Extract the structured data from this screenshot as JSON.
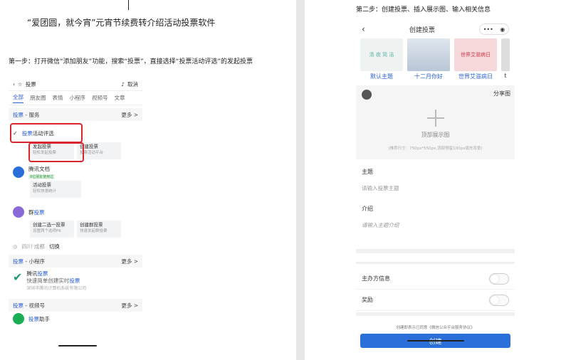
{
  "left": {
    "doc_title": "“爱团圆，就今宵”元宵节续费转介绍活动投票软件",
    "step1_text": "第一步：打开微信“添加朋友”功能，搜索“投票”，直接选择“投票活动评选”的发起投票",
    "search": {
      "query": "投票",
      "cancel": "取消"
    },
    "tabs": [
      "全部",
      "朋友圈",
      "表情",
      "小程序",
      "视频号",
      "文章"
    ],
    "service_section": {
      "title_prefix": "投票",
      "title_suffix": " - 服务",
      "more": "更多 >"
    },
    "item1": {
      "name_prefix": "投票",
      "name_suffix": "活动评选",
      "cards": [
        {
          "title": "发起投票",
          "sub": "轻松发起投票"
        },
        {
          "title": "创建投票",
          "sub": "投票活动平台"
        }
      ]
    },
    "item2": {
      "name": "腾讯文档",
      "tag": "8位朋友使用过",
      "cards": [
        {
          "title": "活动投票",
          "sub": "轻松快速统计"
        }
      ]
    },
    "item3": {
      "name_prefix": "群",
      "name_suffix": "投票",
      "cards": [
        {
          "title": "创建二选一投票",
          "sub": "设置两个选项PK"
        },
        {
          "title": "创建群投票",
          "sub": "快速发起群投票"
        }
      ]
    },
    "location": {
      "place": "四川·成都",
      "switch": "切换"
    },
    "mini_section": {
      "title_prefix": "投票",
      "title_suffix": " - 小程序",
      "more": "更多 >"
    },
    "mini_item": {
      "name_prefix": "腾讯",
      "name_suffix": "投票",
      "desc_a": "快速简单创建实时",
      "desc_b": "投票",
      "company": "深圳市腾讯计算机系统有限公司"
    },
    "video_section": {
      "title_prefix": "投票",
      "title_suffix": " - 视频号",
      "more": "更多 >"
    },
    "video_item": {
      "name_prefix": "投票",
      "name_suffix": "助手"
    }
  },
  "right": {
    "step2_text": "第二步：创建投票、插入展示图、输入相关信息",
    "nav_title": "创建投票",
    "themes": [
      {
        "label": "默认主题",
        "thumb_text": "清 夜 简 洁"
      },
      {
        "label": "十二月你好",
        "thumb_text": ""
      },
      {
        "label": "世界艾滋病日",
        "thumb_text": "世界艾滋病日"
      },
      {
        "label": "t",
        "thumb_text": ""
      }
    ],
    "cover": {
      "share": "分享图",
      "caption": "顶部展示图",
      "hint": "(推荐尺寸：750px*550px,顶部预留100px填充背景)"
    },
    "subject": {
      "label": "主题",
      "placeholder": "请输入投票主题"
    },
    "intro": {
      "label": "介绍",
      "placeholder": "请输入主题介绍"
    },
    "organizer": "主办方信息",
    "prize": "奖励",
    "agree_text": "创建即表示已同意《微信公众平台服务协议》",
    "create_label": "创建"
  },
  "colors": {
    "accent": "#2a5fd6",
    "highlight": "#d8262c",
    "button": "#2b6fd9"
  }
}
